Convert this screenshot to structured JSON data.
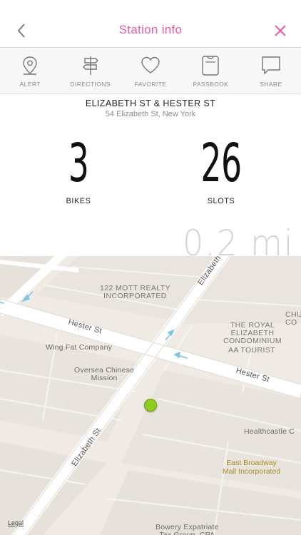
{
  "header": {
    "title": "Station info",
    "accent_color": "#ec5aa5",
    "back_icon": "chevron-left-icon",
    "close_icon": "close-icon"
  },
  "toolbar": {
    "items": [
      {
        "label": "ALERT",
        "icon": "location-pin-icon"
      },
      {
        "label": "DIRECTIONS",
        "icon": "signpost-icon"
      },
      {
        "label": "FAVORITE",
        "icon": "heart-icon"
      },
      {
        "label": "PASSBOOK",
        "icon": "passbook-icon"
      },
      {
        "label": "SHARE",
        "icon": "speech-bubble-icon"
      }
    ]
  },
  "station": {
    "name": "ELIZABETH ST & HESTER ST",
    "address": "54 Elizabeth St, New York",
    "bikes": "3",
    "bikes_label": "BIKES",
    "slots": "26",
    "slots_label": "SLOTS",
    "distance": "0.2 mi"
  },
  "map": {
    "legal": "Legal",
    "streets": {
      "hester_left": "Hester St",
      "hester_right": "Hester St",
      "elizabeth_top": "Elizabeth",
      "elizabeth_bottom": "Elizabeth St"
    },
    "places": {
      "mott_realty": "122 MOTT REALTY\nINCORPORATED",
      "royal_elizabeth": "THE ROYAL\nELIZABETH\nCONDOMINIUM",
      "aa_tourist": "AA TOURIST",
      "chu": "CHU\nCO",
      "wing_fat": "Wing Fat Company",
      "oversea": "Oversea Chinese\nMission",
      "healthcastle": "Healthcastle C",
      "east_broadway": "East Broadway\nMall Incorporated",
      "bowery": "Bowery Expatriate\nTax Group, CPA"
    },
    "pin_color": "#8fcc1f"
  }
}
